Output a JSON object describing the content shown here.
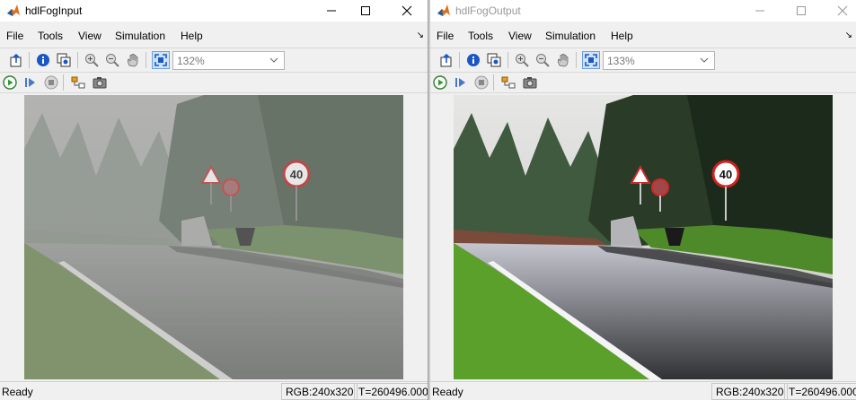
{
  "windows": [
    {
      "title": "hdlFogInput",
      "menu": [
        "File",
        "Tools",
        "View",
        "Simulation",
        "Help"
      ],
      "zoom": "132%",
      "status": {
        "ready": "Ready",
        "rgb": "RGB:240x320",
        "time": "T=260496.000"
      },
      "sign_speed": "40"
    },
    {
      "title": "hdlFogOutput",
      "menu": [
        "File",
        "Tools",
        "View",
        "Simulation",
        "Help"
      ],
      "zoom": "133%",
      "status": {
        "ready": "Ready",
        "rgb": "RGB:240x320",
        "time": "T=260496.000"
      },
      "sign_speed": "40"
    }
  ],
  "icons": {
    "app": "matlab-icon",
    "minimize": "minimize-icon",
    "maximize": "maximize-icon",
    "close": "close-icon",
    "toolbar1": [
      "parent-model-icon",
      "info-icon",
      "print-icon",
      "zoom-in-icon",
      "zoom-out-icon",
      "pan-icon",
      "fit-to-view-icon"
    ],
    "toolbar2": [
      "run-icon",
      "step-forward-icon",
      "stop-icon",
      "highlight-block-icon",
      "snapshot-icon"
    ]
  }
}
